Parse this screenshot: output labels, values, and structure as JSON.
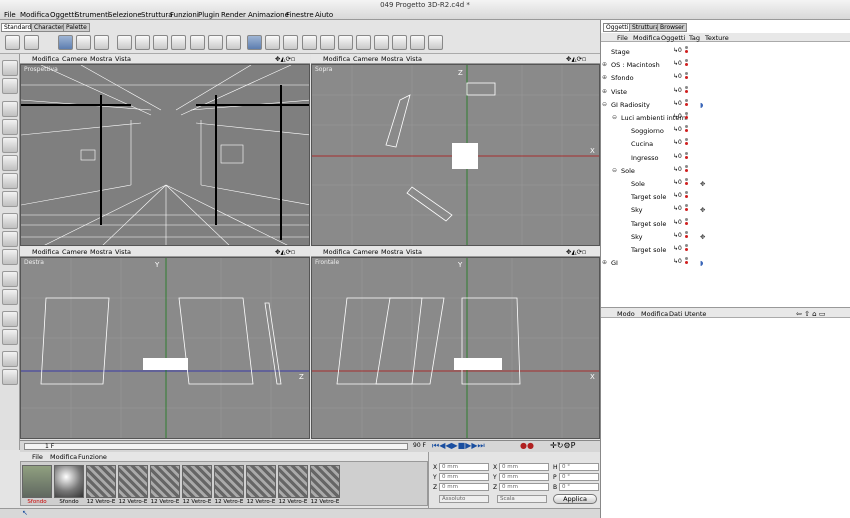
{
  "window": {
    "title": "049 Progetto 3D-R2.c4d *"
  },
  "menu": [
    "File",
    "Modifica",
    "Oggetti",
    "Strumenti",
    "Selezione",
    "Struttura",
    "Funzioni",
    "Plugin",
    "Render",
    "Animazione",
    "Finestre",
    "Aiuto"
  ],
  "layout_tabs": [
    "Standard",
    "Character",
    "Palette"
  ],
  "viewport_menu": [
    "Modifica",
    "Camere",
    "Mostra",
    "Vista"
  ],
  "viewports": [
    {
      "name": "Prospettiva",
      "axes": []
    },
    {
      "name": "Sopra",
      "axes": [
        "Z",
        "X"
      ]
    },
    {
      "name": "Destra",
      "axes": [
        "Y",
        "Z"
      ]
    },
    {
      "name": "Frontale",
      "axes": [
        "Y",
        "X"
      ]
    }
  ],
  "timeline": {
    "start": "1 F",
    "end": "90 F"
  },
  "materials": {
    "menu": [
      "File",
      "Modifica",
      "Funzione"
    ],
    "items": [
      "Sfondo",
      "Sfondo",
      "12 Vetro-E",
      "12 Vetro-E",
      "12 Vetro-E",
      "12 Vetro-E",
      "12 Vetro-E",
      "12 Vetro-E",
      "12 Vetro-E",
      "12 Vetro-E"
    ]
  },
  "coords": {
    "rows": [
      {
        "a": "X",
        "av": "0 mm",
        "b": "X",
        "bv": "0 mm",
        "c": "H",
        "cv": "0 °"
      },
      {
        "a": "Y",
        "av": "0 mm",
        "b": "Y",
        "bv": "0 mm",
        "c": "P",
        "cv": "0 °"
      },
      {
        "a": "Z",
        "av": "0 mm",
        "b": "Z",
        "bv": "0 mm",
        "c": "B",
        "cv": "0 °"
      }
    ],
    "mode1": "Assoluto",
    "mode2": "Scala",
    "apply": "Applica"
  },
  "objects_panel": {
    "tabs": [
      "Oggetti",
      "Struttura",
      "Browser"
    ],
    "menu": [
      "File",
      "Modifica",
      "Oggetti",
      "Tag",
      "Texture"
    ],
    "rows": [
      {
        "name": "Stage",
        "indent": 0,
        "expand": ""
      },
      {
        "name": "OS : Macintosh",
        "indent": 0,
        "expand": "⊕"
      },
      {
        "name": "Sfondo",
        "indent": 0,
        "expand": "⊕"
      },
      {
        "name": "Viste",
        "indent": 0,
        "expand": "⊕"
      },
      {
        "name": "GI Radiosity",
        "indent": 0,
        "expand": "⊖"
      },
      {
        "name": "Luci ambienti interni",
        "indent": 1,
        "expand": "⊖"
      },
      {
        "name": "Soggiorno",
        "indent": 2,
        "expand": ""
      },
      {
        "name": "Cucina",
        "indent": 2,
        "expand": ""
      },
      {
        "name": "Ingresso",
        "indent": 2,
        "expand": ""
      },
      {
        "name": "Sole",
        "indent": 1,
        "expand": "⊖"
      },
      {
        "name": "Sole",
        "indent": 2,
        "expand": ""
      },
      {
        "name": "Target sole",
        "indent": 2,
        "expand": ""
      },
      {
        "name": "Sky",
        "indent": 2,
        "expand": ""
      },
      {
        "name": "Target sole",
        "indent": 2,
        "expand": ""
      },
      {
        "name": "Sky",
        "indent": 2,
        "expand": ""
      },
      {
        "name": "Target sole",
        "indent": 2,
        "expand": ""
      },
      {
        "name": "GI",
        "indent": 0,
        "expand": "⊕"
      }
    ],
    "attr_menu": [
      "Modo",
      "Modifica",
      "Dati Utente"
    ]
  }
}
